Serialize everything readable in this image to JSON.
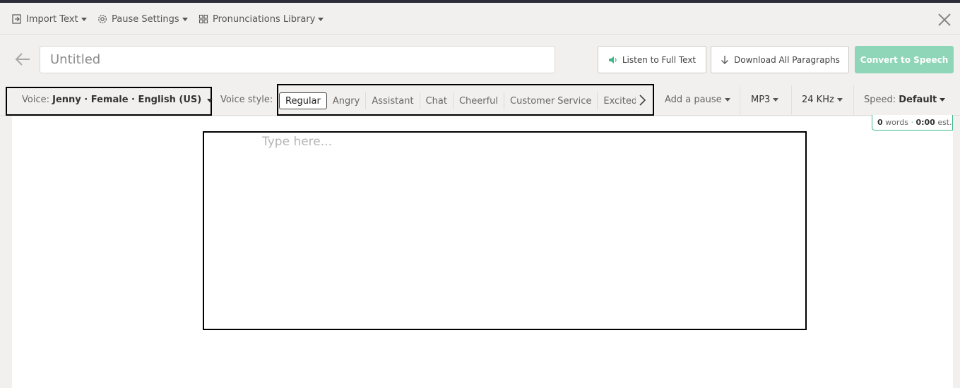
{
  "menu": {
    "import_text": "Import Text",
    "pause_settings": "Pause Settings",
    "pronunciations_library": "Pronunciations Library"
  },
  "title_row": {
    "title_placeholder": "Untitled",
    "listen_label": "Listen to Full Text",
    "download_label": "Download All Paragraphs",
    "convert_label": "Convert to Speech"
  },
  "toolbar": {
    "voice_label": "Voice:",
    "voice_value": "Jenny · Female · English (US)",
    "voice_style_label": "Voice style:",
    "voice_styles": [
      "Regular",
      "Angry",
      "Assistant",
      "Chat",
      "Cheerful",
      "Customer Service",
      "Excited"
    ],
    "active_style": "Regular",
    "add_pause": "Add a pause",
    "format": "MP3",
    "sample_rate": "24 KHz",
    "speed_label": "Speed:",
    "speed_value": "Default"
  },
  "editor": {
    "placeholder": "Type here...",
    "word_count": "0",
    "words_label": "words",
    "dot": "·",
    "duration": "0:00",
    "est_label": "est."
  },
  "colors": {
    "accent_green": "#3fb98a",
    "convert_button": "#8ed6b7",
    "background": "#f1f0ee",
    "top_strip": "#2d2d3a"
  }
}
